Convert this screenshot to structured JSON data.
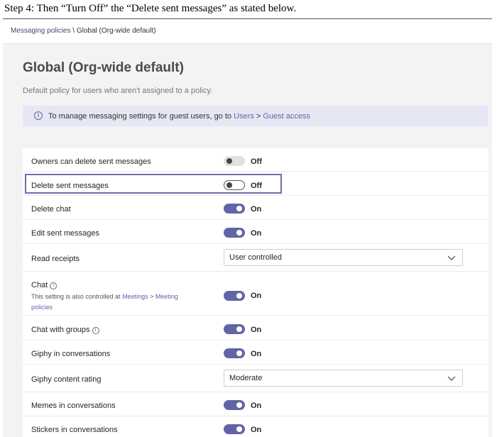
{
  "caption": "Step 4: Then “Turn Off” the “Delete sent messages” as stated below.",
  "breadcrumb": {
    "parent": "Messaging policies",
    "separator": " \\ ",
    "current": "Global (Org-wide default)"
  },
  "page": {
    "title": "Global (Org-wide default)",
    "description": "Default policy for users who aren't assigned to a policy."
  },
  "info": {
    "icon": "info-icon",
    "text": "To manage messaging settings for guest users, go to ",
    "link1": "Users",
    "sep": " > ",
    "link2": "Guest access"
  },
  "settings": {
    "owners_delete": {
      "label": "Owners can delete sent messages",
      "state": "Off"
    },
    "delete_sent": {
      "label": "Delete sent messages",
      "state": "Off"
    },
    "delete_chat": {
      "label": "Delete chat",
      "state": "On"
    },
    "edit_sent": {
      "label": "Edit sent messages",
      "state": "On"
    },
    "read_receipts": {
      "label": "Read receipts",
      "value": "User controlled"
    },
    "chat": {
      "label": "Chat",
      "sub_text": "This setting is also controlled at ",
      "sub_link1": "Meetings",
      "sub_sep": " > ",
      "sub_link2a": "Meeting",
      "sub_link2b": "policies",
      "state": "On"
    },
    "chat_groups": {
      "label": "Chat with groups",
      "state": "On"
    },
    "giphy": {
      "label": "Giphy in conversations",
      "state": "On"
    },
    "giphy_rating": {
      "label": "Giphy content rating",
      "value": "Moderate"
    },
    "memes": {
      "label": "Memes in conversations",
      "state": "On"
    },
    "stickers": {
      "label": "Stickers in conversations",
      "state": "On"
    }
  },
  "colors": {
    "accent": "#6264a7",
    "highlight": "#6d6ea8",
    "banner": "#e6e7f4"
  }
}
